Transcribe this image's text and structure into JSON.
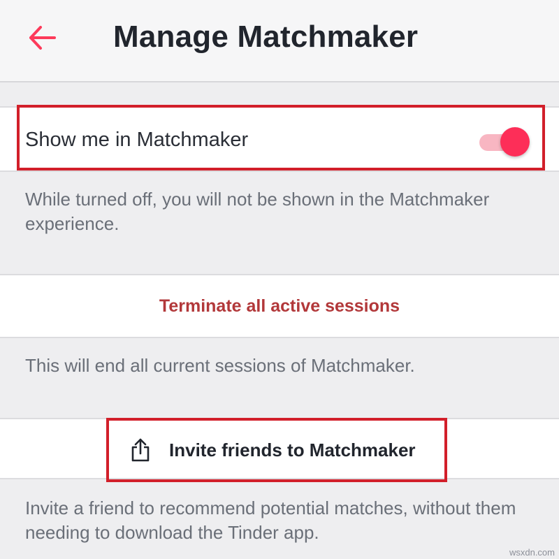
{
  "header": {
    "title": "Manage Matchmaker",
    "back_icon": "arrow-left-icon",
    "accent_color": "#fd3a5a"
  },
  "show_in_matchmaker": {
    "label": "Show me in Matchmaker",
    "toggle_on": true,
    "toggle_color": "#fd2e58"
  },
  "notes": {
    "toggle_note": "While turned off, you will not be shown in the Matchmaker experience.",
    "terminate_note": "This will end all current sessions of Matchmaker.",
    "invite_note": "Invite a friend to recommend potential matches, without them needing to download the Tinder app."
  },
  "actions": {
    "terminate_label": "Terminate all active sessions",
    "terminate_color": "#b2383a",
    "invite_label": "Invite friends to Matchmaker",
    "invite_icon": "share-icon"
  },
  "annotations": {
    "highlight_color": "#d21f2a"
  },
  "watermark": "wsxdn.com"
}
